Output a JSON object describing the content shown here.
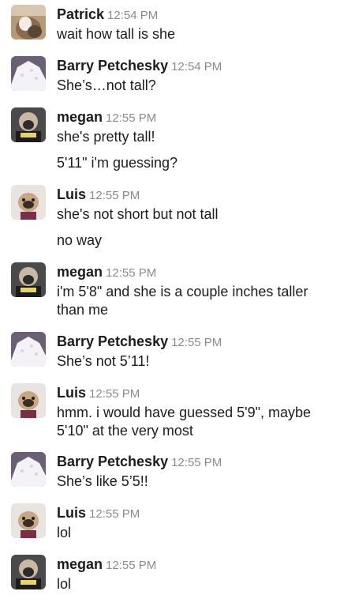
{
  "messages": [
    {
      "author": "Patrick",
      "time": "12:54 PM",
      "avatar": "patrick-avatar",
      "lines": [
        "wait how tall is she"
      ]
    },
    {
      "author": "Barry Petchesky",
      "time": "12:54 PM",
      "avatar": "salt-avatar",
      "lines": [
        "She’s…not tall?"
      ]
    },
    {
      "author": "megan",
      "time": "12:55 PM",
      "avatar": "dog-avatar",
      "lines": [
        "she's pretty tall!",
        "5'11\" i'm guessing?"
      ]
    },
    {
      "author": "Luis",
      "time": "12:55 PM",
      "avatar": "pug-avatar",
      "lines": [
        "she's not short but not tall",
        "no way"
      ]
    },
    {
      "author": "megan",
      "time": "12:55 PM",
      "avatar": "dog-avatar",
      "lines": [
        "i'm 5'8\" and she is a couple inches taller than me"
      ]
    },
    {
      "author": "Barry Petchesky",
      "time": "12:55 PM",
      "avatar": "salt-avatar",
      "lines": [
        "She’s not 5’11!"
      ]
    },
    {
      "author": "Luis",
      "time": "12:55 PM",
      "avatar": "pug-avatar",
      "lines": [
        "hmm. i would have guessed 5'9\", maybe 5'10\" at the very most"
      ]
    },
    {
      "author": "Barry Petchesky",
      "time": "12:55 PM",
      "avatar": "salt-avatar",
      "lines": [
        "She’s like 5’5!!"
      ]
    },
    {
      "author": "Luis",
      "time": "12:55 PM",
      "avatar": "pug-avatar",
      "lines": [
        "lol"
      ]
    },
    {
      "author": "megan",
      "time": "12:55 PM",
      "avatar": "dog-avatar",
      "lines": [
        "lol"
      ]
    }
  ]
}
